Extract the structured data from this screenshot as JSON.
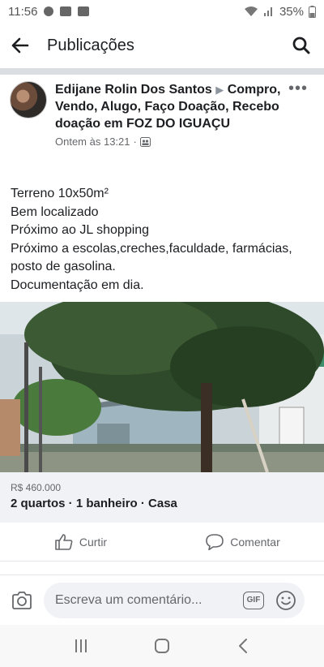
{
  "status_bar": {
    "time": "11:56",
    "battery": "35%"
  },
  "app_bar": {
    "title": "Publicações"
  },
  "post": {
    "author": "Edijane Rolin Dos Santos",
    "group": "Compro, Vendo, Alugo, Faço Doação, Recebo doação em FOZ DO IGUAÇU",
    "timestamp": "Ontem às 13:21",
    "body_lines": [
      "Terreno 10x50m²",
      "Bem localizado",
      "Próximo ao JL shopping",
      "Próximo a escolas,creches,faculdade, farmácias, posto de gasolina.",
      "Documentação em dia."
    ]
  },
  "listing": {
    "price": "R$ 460.000",
    "details": "2 quartos · 1 banheiro · Casa"
  },
  "actions": {
    "like_label": "Curtir",
    "comment_label": "Comentar"
  },
  "comment_bar": {
    "placeholder": "Escreva um comentário...",
    "gif_label": "GIF"
  },
  "icons": [
    "back-arrow-icon",
    "search-icon",
    "more-icon",
    "globe-icon",
    "like-icon",
    "comment-icon",
    "camera-icon",
    "gif-icon",
    "emoji-icon",
    "recent-apps-icon",
    "home-icon",
    "back-nav-icon"
  ],
  "colors": {
    "divider": "#dadde1",
    "listing_bg": "#f0f2f5",
    "secondary_text": "#65676b"
  }
}
